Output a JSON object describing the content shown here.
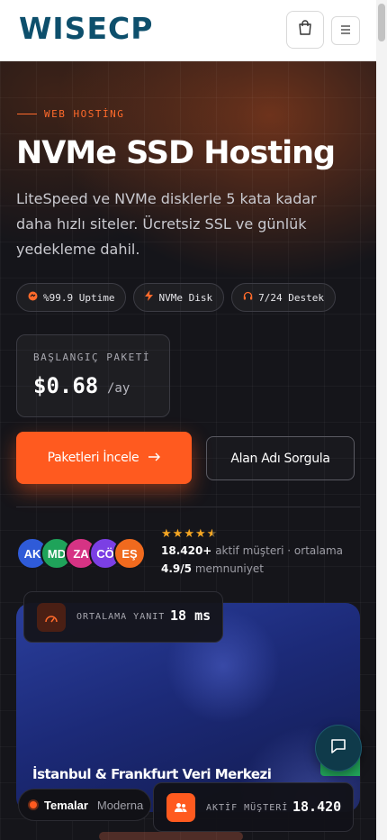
{
  "header": {
    "logo_text": "WISECP",
    "cart_icon": "shopping-bag-icon",
    "menu_icon": "hamburger-icon"
  },
  "hero": {
    "eyebrow": "WEB HOSTİNG",
    "title": "NVMe SSD Hosting",
    "description": "LiteSpeed ve NVMe disklerle 5 kata kadar daha hızlı siteler. Ücretsiz SSL ve günlük yedekleme dahil.",
    "badges": [
      {
        "label": "%99.9 Uptime",
        "icon": "uptime-icon"
      },
      {
        "label": "NVMe Disk",
        "icon": "bolt-icon"
      },
      {
        "label": "7/24 Destek",
        "icon": "headset-icon"
      }
    ],
    "price": {
      "label": "BAŞLANGIÇ PAKETİ",
      "value": "$0.68",
      "period": "/ay"
    },
    "primary_button": "Paketleri İncele",
    "secondary_button": "Alan Adı Sorgula"
  },
  "social_proof": {
    "avatars": [
      {
        "initials": "AK",
        "color": "#2f5bd8"
      },
      {
        "initials": "MD",
        "color": "#1fa35a"
      },
      {
        "initials": "ZA",
        "color": "#d63384"
      },
      {
        "initials": "CÖ",
        "color": "#7b3fe4"
      },
      {
        "initials": "EŞ",
        "color": "#f06a1e"
      }
    ],
    "rating": 4.5,
    "customers_count": "18.420+",
    "customers_text": "aktif müşteri · ortalama",
    "average": "4.9/5",
    "satisfaction_text": "memnuniyet"
  },
  "datacenter": {
    "title": "İstanbul & Frankfurt Veri Merkezi"
  },
  "latency": {
    "label": "ORTALAMA YANIT",
    "value": "18 ms",
    "icon": "speedometer-icon"
  },
  "customers": {
    "label": "AKTİF MÜŞTERİ",
    "value": "18.420",
    "icon": "users-icon"
  },
  "theme": {
    "label": "Temalar",
    "value": "Moderna"
  },
  "chat": {
    "icon": "chat-bubble-icon"
  },
  "colors": {
    "accent": "#ff5a1f",
    "brand": "#0d4f6c",
    "background_dark": "#15151a"
  }
}
